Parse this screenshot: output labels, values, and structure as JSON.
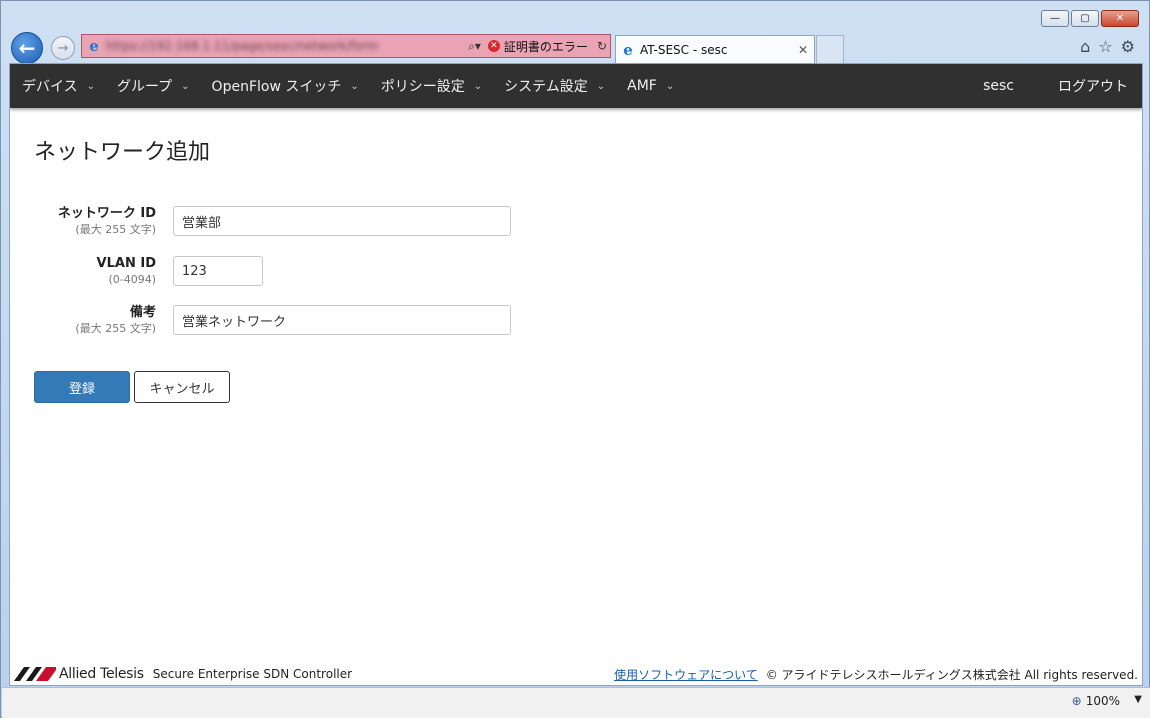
{
  "browser": {
    "address_url": "https://192.168.1.11/page/sesc/network/form",
    "cert_error": "証明書のエラー",
    "tab_title": "AT-SESC - sesc",
    "zoom": "100%"
  },
  "navbar": {
    "items": [
      {
        "label": "デバイス"
      },
      {
        "label": "グループ"
      },
      {
        "label": "OpenFlow スイッチ"
      },
      {
        "label": "ポリシー設定"
      },
      {
        "label": "システム設定"
      },
      {
        "label": "AMF"
      }
    ],
    "user": "sesc",
    "logout": "ログアウト"
  },
  "page": {
    "title": "ネットワーク追加"
  },
  "form": {
    "network_id": {
      "label": "ネットワーク ID",
      "hint": "(最大 255 文字)",
      "value": "営業部"
    },
    "vlan_id": {
      "label": "VLAN ID",
      "hint": "(0-4094)",
      "value": "123"
    },
    "note": {
      "label": "備考",
      "hint": "(最大 255 文字)",
      "value": "営業ネットワーク"
    },
    "submit_label": "登録",
    "cancel_label": "キャンセル"
  },
  "footer": {
    "brand": "Allied Telesis",
    "product": "Secure Enterprise SDN Controller",
    "software_link": "使用ソフトウェアについて",
    "copyright": "© アライドテレシスホールディングス株式会社 All rights reserved."
  },
  "colors": {
    "navbar_bg": "#303030",
    "primary": "#337ab7",
    "address_error": "#e9a3b3"
  }
}
